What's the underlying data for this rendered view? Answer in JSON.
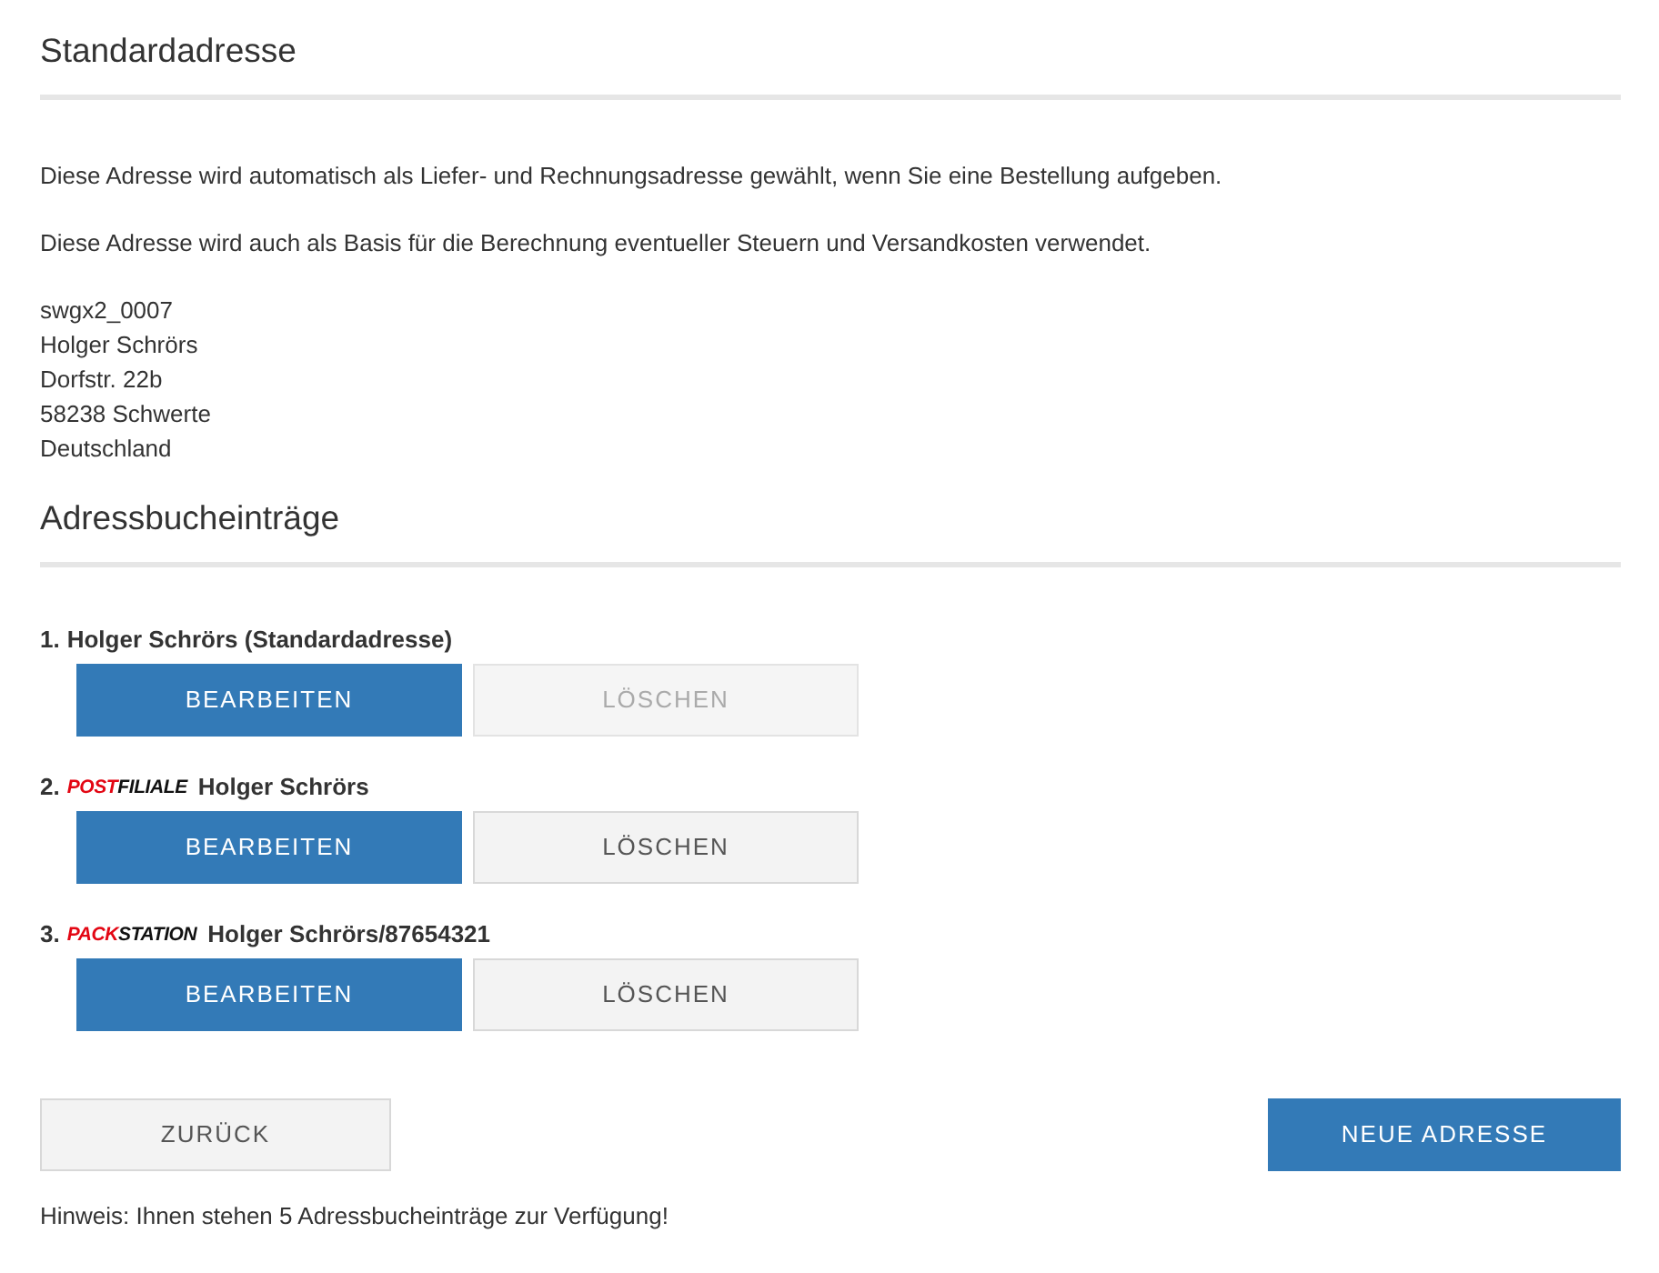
{
  "default_address": {
    "heading": "Standardadresse",
    "notes": [
      "Diese Adresse wird automatisch als Liefer- und Rechnungsadresse gewählt, wenn Sie eine Bestellung aufgeben.",
      "Diese Adresse wird auch als Basis für die Berechnung eventueller Steuern und Versandkosten verwendet."
    ],
    "lines": [
      "swgx2_0007",
      "Holger Schrörs",
      "Dorfstr. 22b",
      "58238 Schwerte",
      "Deutschland"
    ]
  },
  "address_book": {
    "heading": "Adressbucheinträge",
    "entries": [
      {
        "number": "1.",
        "name": "Holger Schrörs (Standardadresse)",
        "edit": "BEARBEITEN",
        "delete": {
          "label": "LÖSCHEN",
          "disabled": true
        }
      },
      {
        "number": "2.",
        "logo": {
          "accent": "POST",
          "rest": "FILIALE"
        },
        "name": "Holger Schrörs",
        "edit": "BEARBEITEN",
        "delete": {
          "label": "LÖSCHEN",
          "disabled": false
        }
      },
      {
        "number": "3.",
        "logo": {
          "accent": "PACK",
          "rest": "STATION"
        },
        "name": "Holger Schrörs/87654321",
        "edit": "BEARBEITEN",
        "delete": {
          "label": "LÖSCHEN",
          "disabled": false
        }
      }
    ]
  },
  "actions": {
    "back": "ZURÜCK",
    "new_address": "NEUE ADRESSE"
  },
  "hint": "Hinweis: Ihnen stehen 5 Adressbucheinträge zur Verfügung!"
}
